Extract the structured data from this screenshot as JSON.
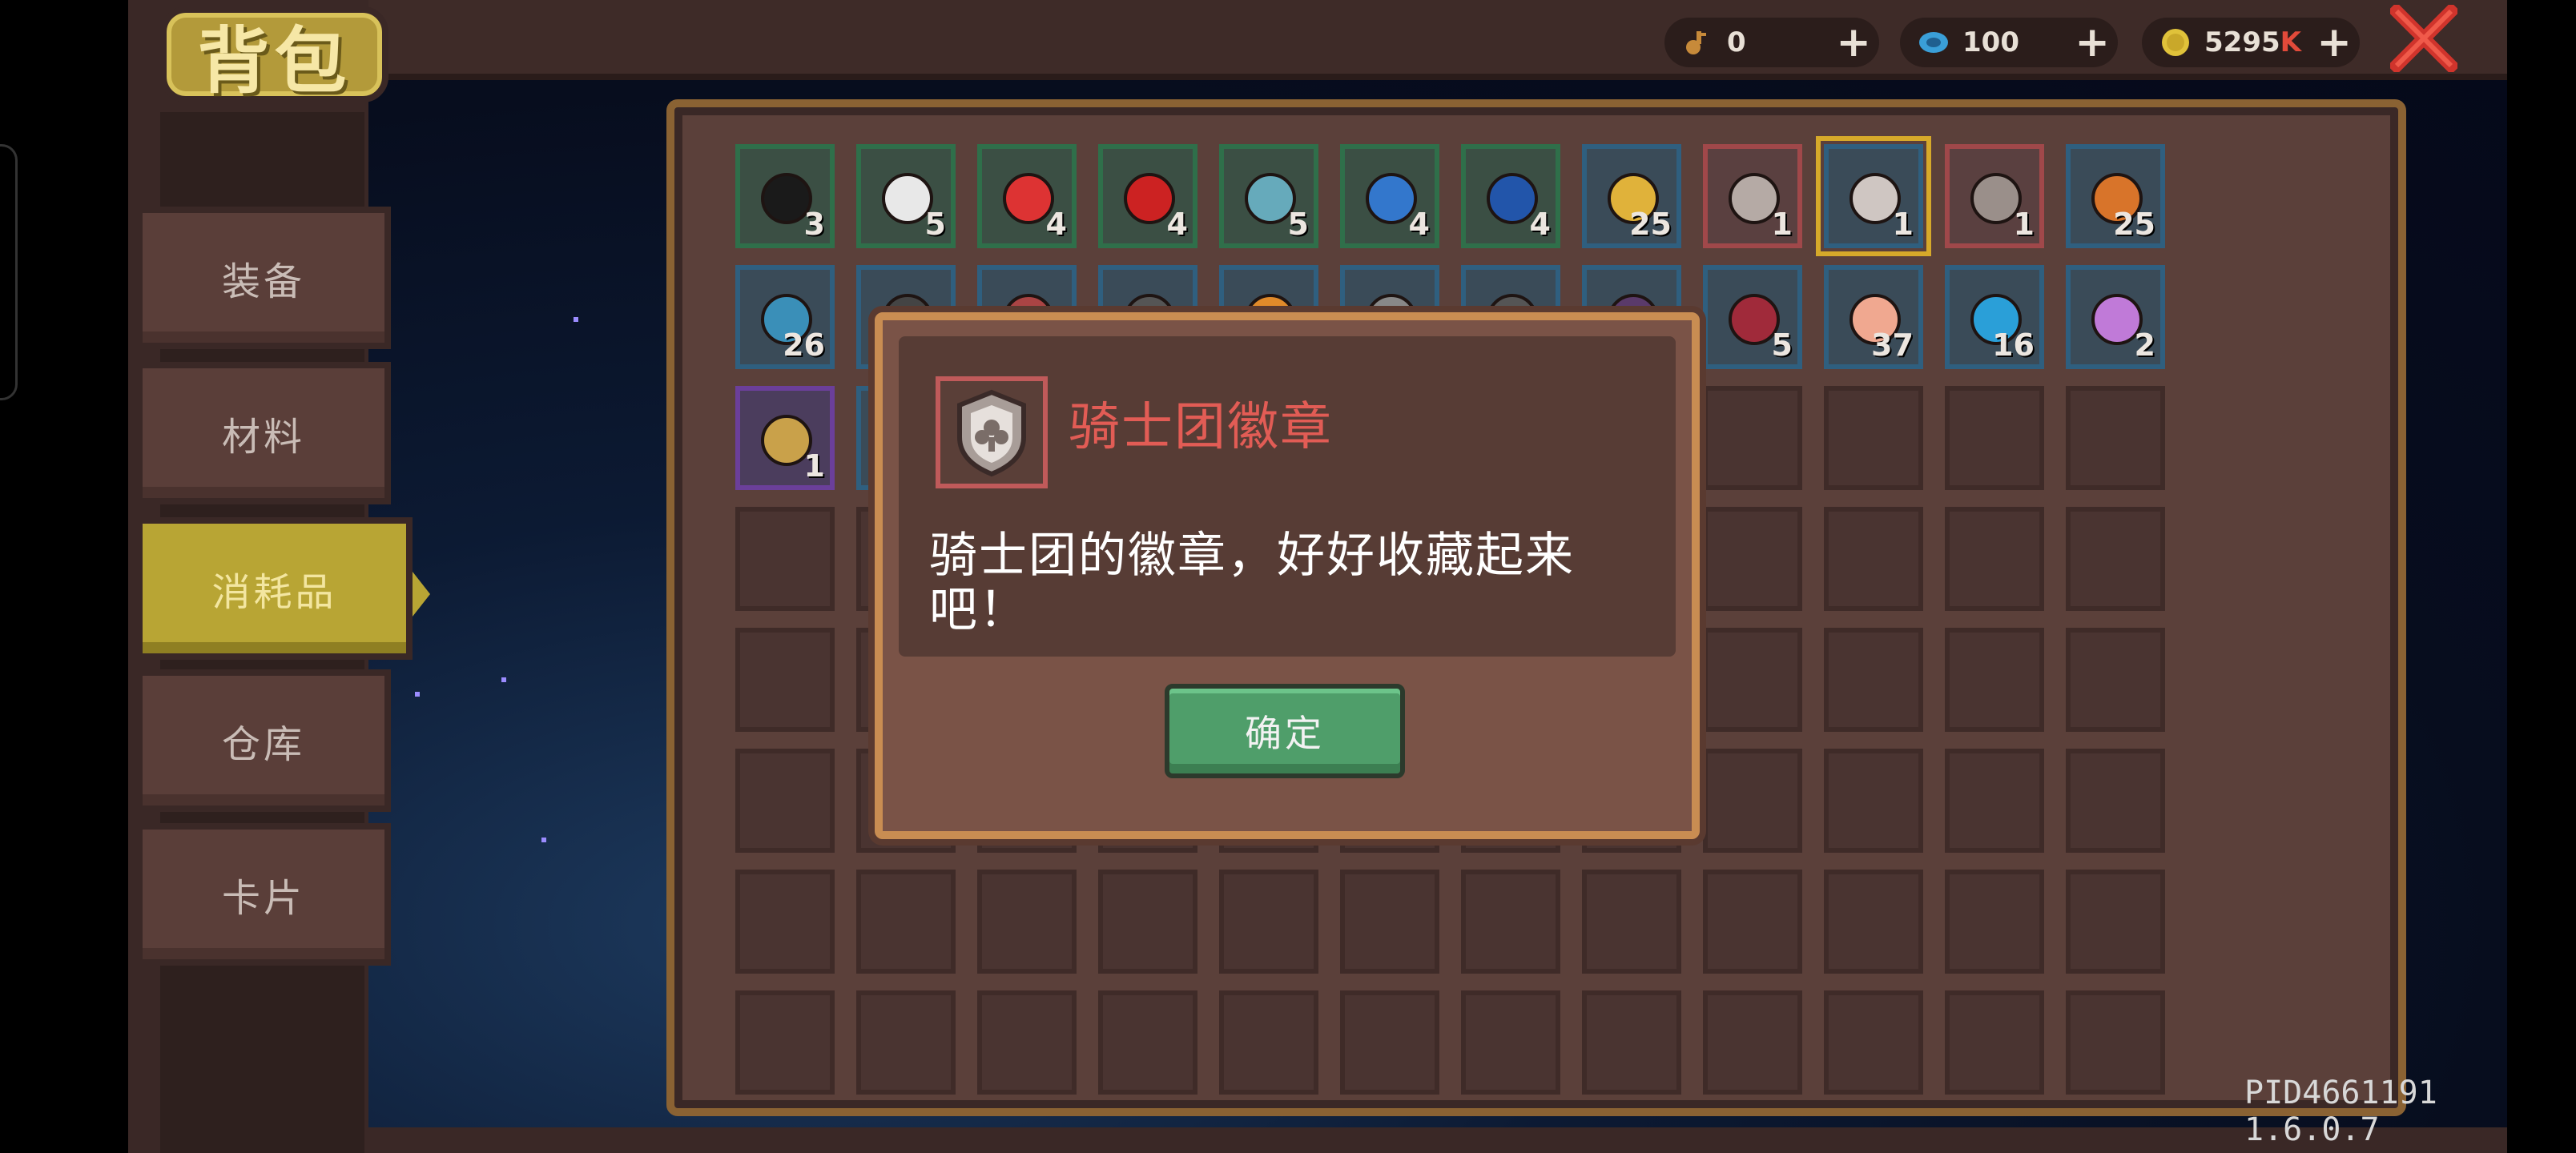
{
  "header": {
    "title": "背包",
    "currencies": [
      {
        "name": "key-icon",
        "value": "0"
      },
      {
        "name": "gem-icon",
        "value": "100"
      },
      {
        "name": "coin-icon",
        "value": "5295",
        "suffix": "K"
      }
    ],
    "plus_label": "+",
    "close_icon": "close-x-icon"
  },
  "tabs": [
    {
      "label": "装备"
    },
    {
      "label": "材料"
    },
    {
      "label": "消耗品",
      "active": true
    },
    {
      "label": "仓库"
    },
    {
      "label": "卡片"
    }
  ],
  "inventory": {
    "row1": [
      "3",
      "5",
      "4",
      "4",
      "5",
      "4",
      "4",
      "25",
      "1",
      "1",
      "1",
      "25"
    ],
    "row2": [
      "26",
      "",
      "",
      "",
      "",
      "",
      "",
      "",
      "5",
      "37",
      "16",
      "2"
    ],
    "row3": [
      "1",
      ""
    ]
  },
  "dialog": {
    "title": "骑士团徽章",
    "description": "骑士团的徽章，好好收藏起来吧！",
    "confirm_label": "确定"
  },
  "footer": {
    "build": "PID4661191 1.6.0.7"
  },
  "colors": {
    "frame": "#3a2826",
    "active_tab": "#b8a534",
    "dialog_title": "#e25c55",
    "confirm_button": "#4f9e6a",
    "currency_k": "#e24a3a"
  }
}
